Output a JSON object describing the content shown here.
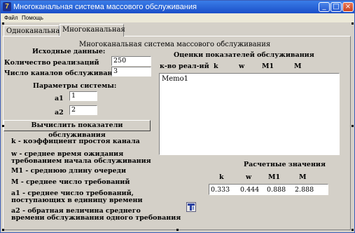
{
  "window": {
    "title": "Многоканальная система массового обслуживания",
    "app_icon": "7",
    "controls": {
      "minimize": "_",
      "maximize": "□",
      "close": "×"
    }
  },
  "menu": {
    "file": "Файл",
    "help": "Помощь"
  },
  "tabs": [
    {
      "label": "Одноканальная"
    },
    {
      "label": "Многоканальная"
    }
  ],
  "heading": "Многоканальная система массового обслуживания",
  "inputs": {
    "section_title": "Исходные данные:",
    "realizations_label": "Количество реализаций",
    "realizations_value": "250",
    "channels_label": "Число каналов обслуживания",
    "channels_value": "3"
  },
  "params": {
    "section_title": "Параметры системы:",
    "a1_label": "a1",
    "a1_value": "1",
    "a2_label": "a2",
    "a2_value": "2"
  },
  "compute_button": "Вычислить показатели обслуживания",
  "legend": {
    "k": "k - коэффициент простоя канала",
    "w1": "w - среднее время ожидания",
    "w2": "требованием начала обслуживания",
    "m1": "M1 - среднюю длину очереди",
    "m": "M - среднее число требований",
    "a1_1": "a1 - среднее число требований,",
    "a1_2": "поступающих в единицу времени",
    "a2_1": "a2 - обратная величина среднего",
    "a2_2": "времени обслуживания одного требования"
  },
  "estimates": {
    "title": "Оценки показателей обслуживания",
    "col_realizations": "к-во реал-ий",
    "col_k": "k",
    "col_w": "w",
    "col_m1": "M1",
    "col_m": "M",
    "memo_text": "Memo1"
  },
  "calculated": {
    "title": "Расчетные значения",
    "col_k": "k",
    "col_w": "w",
    "col_m1": "M1",
    "col_m": "M",
    "k": "0.333",
    "w": "0.444",
    "m1": "0.888",
    "m": "2.888"
  },
  "icons": {
    "titlebar": "app-icon",
    "bottom": "tool-icon"
  }
}
